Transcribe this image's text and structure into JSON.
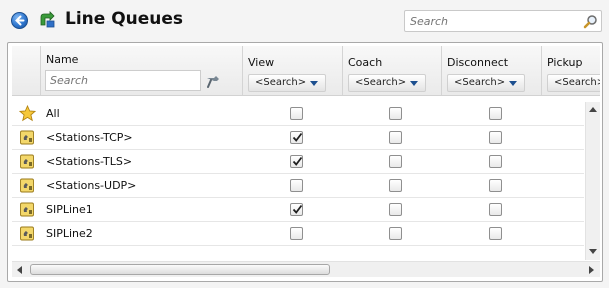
{
  "header": {
    "title": "Line Queues",
    "back_icon": "back-arrow-icon",
    "app_icon": "line-queues-icon",
    "search": {
      "placeholder": "Search",
      "value": ""
    }
  },
  "grid": {
    "name_column": {
      "label": "Name",
      "search_placeholder": "Search",
      "search_value": ""
    },
    "columns": [
      {
        "label": "View",
        "filter": "<Search>"
      },
      {
        "label": "Coach",
        "filter": "<Search>"
      },
      {
        "label": "Disconnect",
        "filter": "<Search>"
      },
      {
        "label": "Pickup",
        "filter": "<Search>"
      }
    ],
    "rows": [
      {
        "name": "All",
        "icon": "star-icon",
        "view": false,
        "coach": false,
        "disconnect": false
      },
      {
        "name": "<Stations-TCP>",
        "icon": "station-icon",
        "view": true,
        "coach": false,
        "disconnect": false
      },
      {
        "name": "<Stations-TLS>",
        "icon": "station-icon",
        "view": true,
        "coach": false,
        "disconnect": false
      },
      {
        "name": "<Stations-UDP>",
        "icon": "station-icon",
        "view": false,
        "coach": false,
        "disconnect": false
      },
      {
        "name": "SIPLine1",
        "icon": "line-icon",
        "view": true,
        "coach": false,
        "disconnect": false
      },
      {
        "name": "SIPLine2",
        "icon": "line-icon",
        "view": false,
        "coach": false,
        "disconnect": false
      }
    ]
  },
  "colors": {
    "accent": "#2f77cf",
    "panel_border": "#a9a9a9",
    "check": "#1f1f1f"
  }
}
